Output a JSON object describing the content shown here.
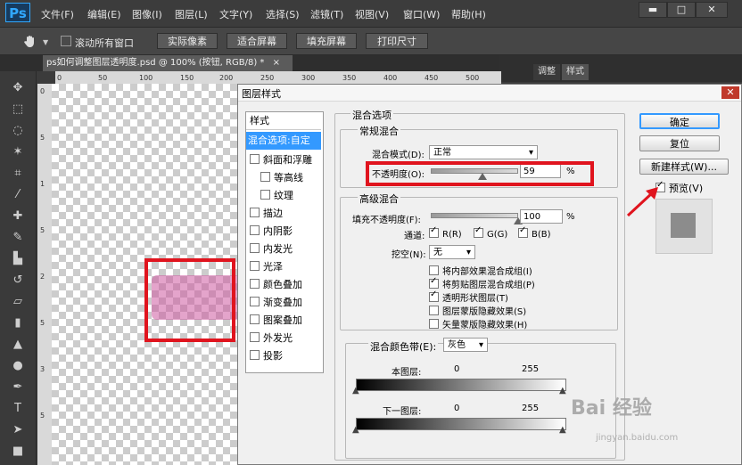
{
  "app": {
    "logo": "Ps"
  },
  "menu": [
    "文件(F)",
    "编辑(E)",
    "图像(I)",
    "图层(L)",
    "文字(Y)",
    "选择(S)",
    "滤镜(T)",
    "视图(V)",
    "窗口(W)",
    "帮助(H)"
  ],
  "window_controls": {
    "minimize": "▬",
    "maximize": "□",
    "close": "✕"
  },
  "options_bar": {
    "tool_icon": "hand-icon",
    "scroll_all_label": "滚动所有窗口",
    "buttons": [
      "实际像素",
      "适合屏幕",
      "填充屏幕",
      "打印尺寸"
    ]
  },
  "document_tab": {
    "title": "ps如何调整图层透明度.psd @ 100% (按钮, RGB/8) *",
    "close": "×"
  },
  "panel_tabs": [
    "调整",
    "样式"
  ],
  "ruler": {
    "h_ticks": [
      "0",
      "50",
      "100",
      "150",
      "200",
      "250",
      "300",
      "350",
      "400",
      "450",
      "500"
    ],
    "v_ticks": [
      "0",
      "5",
      "1",
      "5",
      "2",
      "5",
      "3",
      "5"
    ]
  },
  "toolbox_icons": [
    "move-icon",
    "marquee-icon",
    "lasso-icon",
    "magic-wand-icon",
    "crop-icon",
    "eyedropper-icon",
    "healing-icon",
    "brush-icon",
    "stamp-icon",
    "history-brush-icon",
    "eraser-icon",
    "gradient-icon",
    "blur-icon",
    "dodge-icon",
    "pen-icon",
    "type-icon",
    "path-select-icon",
    "shape-icon"
  ],
  "dialog": {
    "title": "图层样式",
    "close": "✕",
    "styles_header": "样式",
    "styles": [
      {
        "label": "混合选项:自定",
        "selected": true,
        "checkbox": false,
        "checked": false
      },
      {
        "label": "斜面和浮雕",
        "checkbox": true,
        "checked": false
      },
      {
        "label": "等高线",
        "checkbox": true,
        "checked": false,
        "indent": true
      },
      {
        "label": "纹理",
        "checkbox": true,
        "checked": false,
        "indent": true
      },
      {
        "label": "描边",
        "checkbox": true,
        "checked": false
      },
      {
        "label": "内阴影",
        "checkbox": true,
        "checked": false
      },
      {
        "label": "内发光",
        "checkbox": true,
        "checked": false
      },
      {
        "label": "光泽",
        "checkbox": true,
        "checked": false
      },
      {
        "label": "颜色叠加",
        "checkbox": true,
        "checked": false
      },
      {
        "label": "渐变叠加",
        "checkbox": true,
        "checked": false
      },
      {
        "label": "图案叠加",
        "checkbox": true,
        "checked": false
      },
      {
        "label": "外发光",
        "checkbox": true,
        "checked": false
      },
      {
        "label": "投影",
        "checkbox": true,
        "checked": false
      }
    ],
    "blend_options_title": "混合选项",
    "general_title": "常规混合",
    "blend_mode_label": "混合模式(D):",
    "blend_mode_value": "正常",
    "opacity_label": "不透明度(O):",
    "opacity_value": "59",
    "opacity_fraction": 0.59,
    "percent": "%",
    "advanced_title": "高级混合",
    "fill_opacity_label": "填充不透明度(F):",
    "fill_opacity_value": "100",
    "fill_fraction": 1.0,
    "channels_label": "通道:",
    "channels": [
      "R(R)",
      "G(G)",
      "B(B)"
    ],
    "knockout_label": "挖空(N):",
    "knockout_value": "无",
    "advanced_options": [
      {
        "label": "将内部效果混合成组(I)",
        "checked": false
      },
      {
        "label": "将剪贴图层混合成组(P)",
        "checked": true
      },
      {
        "label": "透明形状图层(T)",
        "checked": true
      },
      {
        "label": "图层蒙版隐藏效果(S)",
        "checked": false
      },
      {
        "label": "矢量蒙版隐藏效果(H)",
        "checked": false
      }
    ],
    "blend_if_label": "混合颜色带(E):",
    "blend_if_value": "灰色",
    "this_layer_label": "本图层:",
    "this_layer_min": "0",
    "this_layer_max": "255",
    "underlying_label": "下一图层:",
    "underlying_min": "0",
    "underlying_max": "255",
    "ok": "确定",
    "reset": "复位",
    "new_style": "新建样式(W)...",
    "preview_label": "预览(V)",
    "preview_checked": true
  },
  "colors": {
    "highlight": "#e0141e",
    "selection": "#3399ff",
    "layer_fill": "#cd5aa0"
  },
  "watermark": {
    "text": "Bai 经验",
    "sub": "jingyan.baidu.com"
  }
}
